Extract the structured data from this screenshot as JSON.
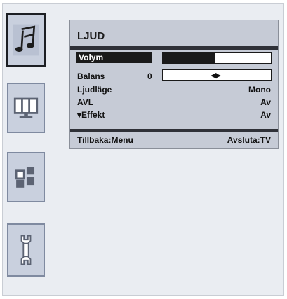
{
  "sidebar": {
    "items": [
      {
        "name": "music-note-icon",
        "active": true
      },
      {
        "name": "monitor-icon",
        "active": false
      },
      {
        "name": "blocks-icon",
        "active": false
      },
      {
        "name": "wrench-icon",
        "active": false
      }
    ]
  },
  "menu": {
    "title": "LJUD",
    "rows": [
      {
        "label": "Volym",
        "value": ""
      },
      {
        "label": "Balans",
        "value": "0"
      },
      {
        "label": "Ljudläge",
        "value": "Mono"
      },
      {
        "label": "AVL",
        "value": "Av"
      },
      {
        "label": "▾Effekt",
        "value": "Av"
      }
    ],
    "volume_level": 0.52,
    "balance_arrows": "◀▶",
    "footer_left": "Tillbaka:Menu",
    "footer_right": "Avsluta:TV"
  },
  "colors": {
    "panel_bg": "#c6cbd6",
    "selection": "#1a1a1a"
  }
}
